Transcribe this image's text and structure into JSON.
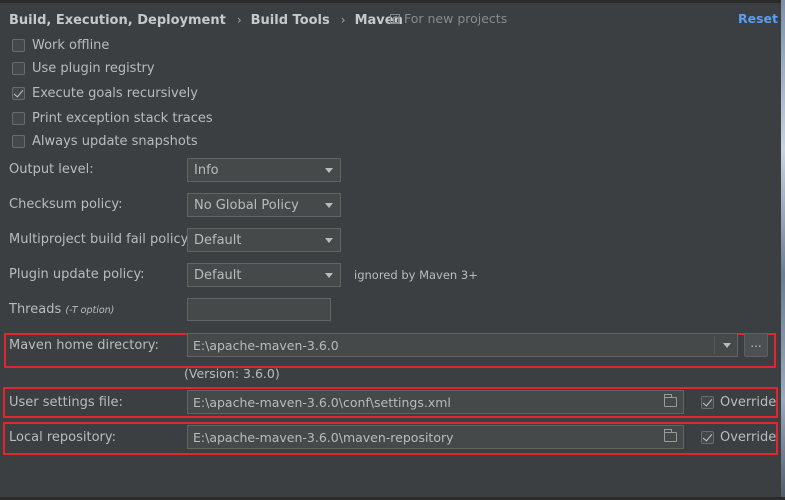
{
  "header": {
    "breadcrumb": [
      "Build, Execution, Deployment",
      "Build Tools",
      "Maven"
    ],
    "separator": "›",
    "scope_label": "For new projects",
    "reset_label": "Reset"
  },
  "checkboxes": [
    {
      "label": "Work offline",
      "checked": false
    },
    {
      "label": "Use plugin registry",
      "checked": false
    },
    {
      "label": "Execute goals recursively",
      "checked": true
    },
    {
      "label": "Print exception stack traces",
      "checked": false
    },
    {
      "label": "Always update snapshots",
      "checked": false
    }
  ],
  "settings": {
    "output_level": {
      "label": "Output level:",
      "value": "Info"
    },
    "checksum_policy": {
      "label": "Checksum policy:",
      "value": "No Global Policy"
    },
    "multiproject_fail_policy": {
      "label": "Multiproject build fail policy:",
      "value": "Default"
    },
    "plugin_update_policy": {
      "label": "Plugin update policy:",
      "value": "Default",
      "note": "ignored by Maven 3+"
    },
    "threads": {
      "label": "Threads",
      "hint": "(-T option)",
      "value": ""
    }
  },
  "maven_home": {
    "label": "Maven home directory:",
    "value": "E:\\apache-maven-3.6.0",
    "browse_label": "...",
    "version_text": "(Version: 3.6.0)"
  },
  "user_settings": {
    "label": "User settings file:",
    "value": "E:\\apache-maven-3.6.0\\conf\\settings.xml",
    "override_label": "Override",
    "override_checked": true
  },
  "local_repository": {
    "label": "Local repository:",
    "value": "E:\\apache-maven-3.6.0\\maven-repository",
    "override_label": "Override",
    "override_checked": true
  },
  "colors": {
    "background": "#3c3f41",
    "link": "#589df6",
    "highlight_box": "#e0262e"
  }
}
